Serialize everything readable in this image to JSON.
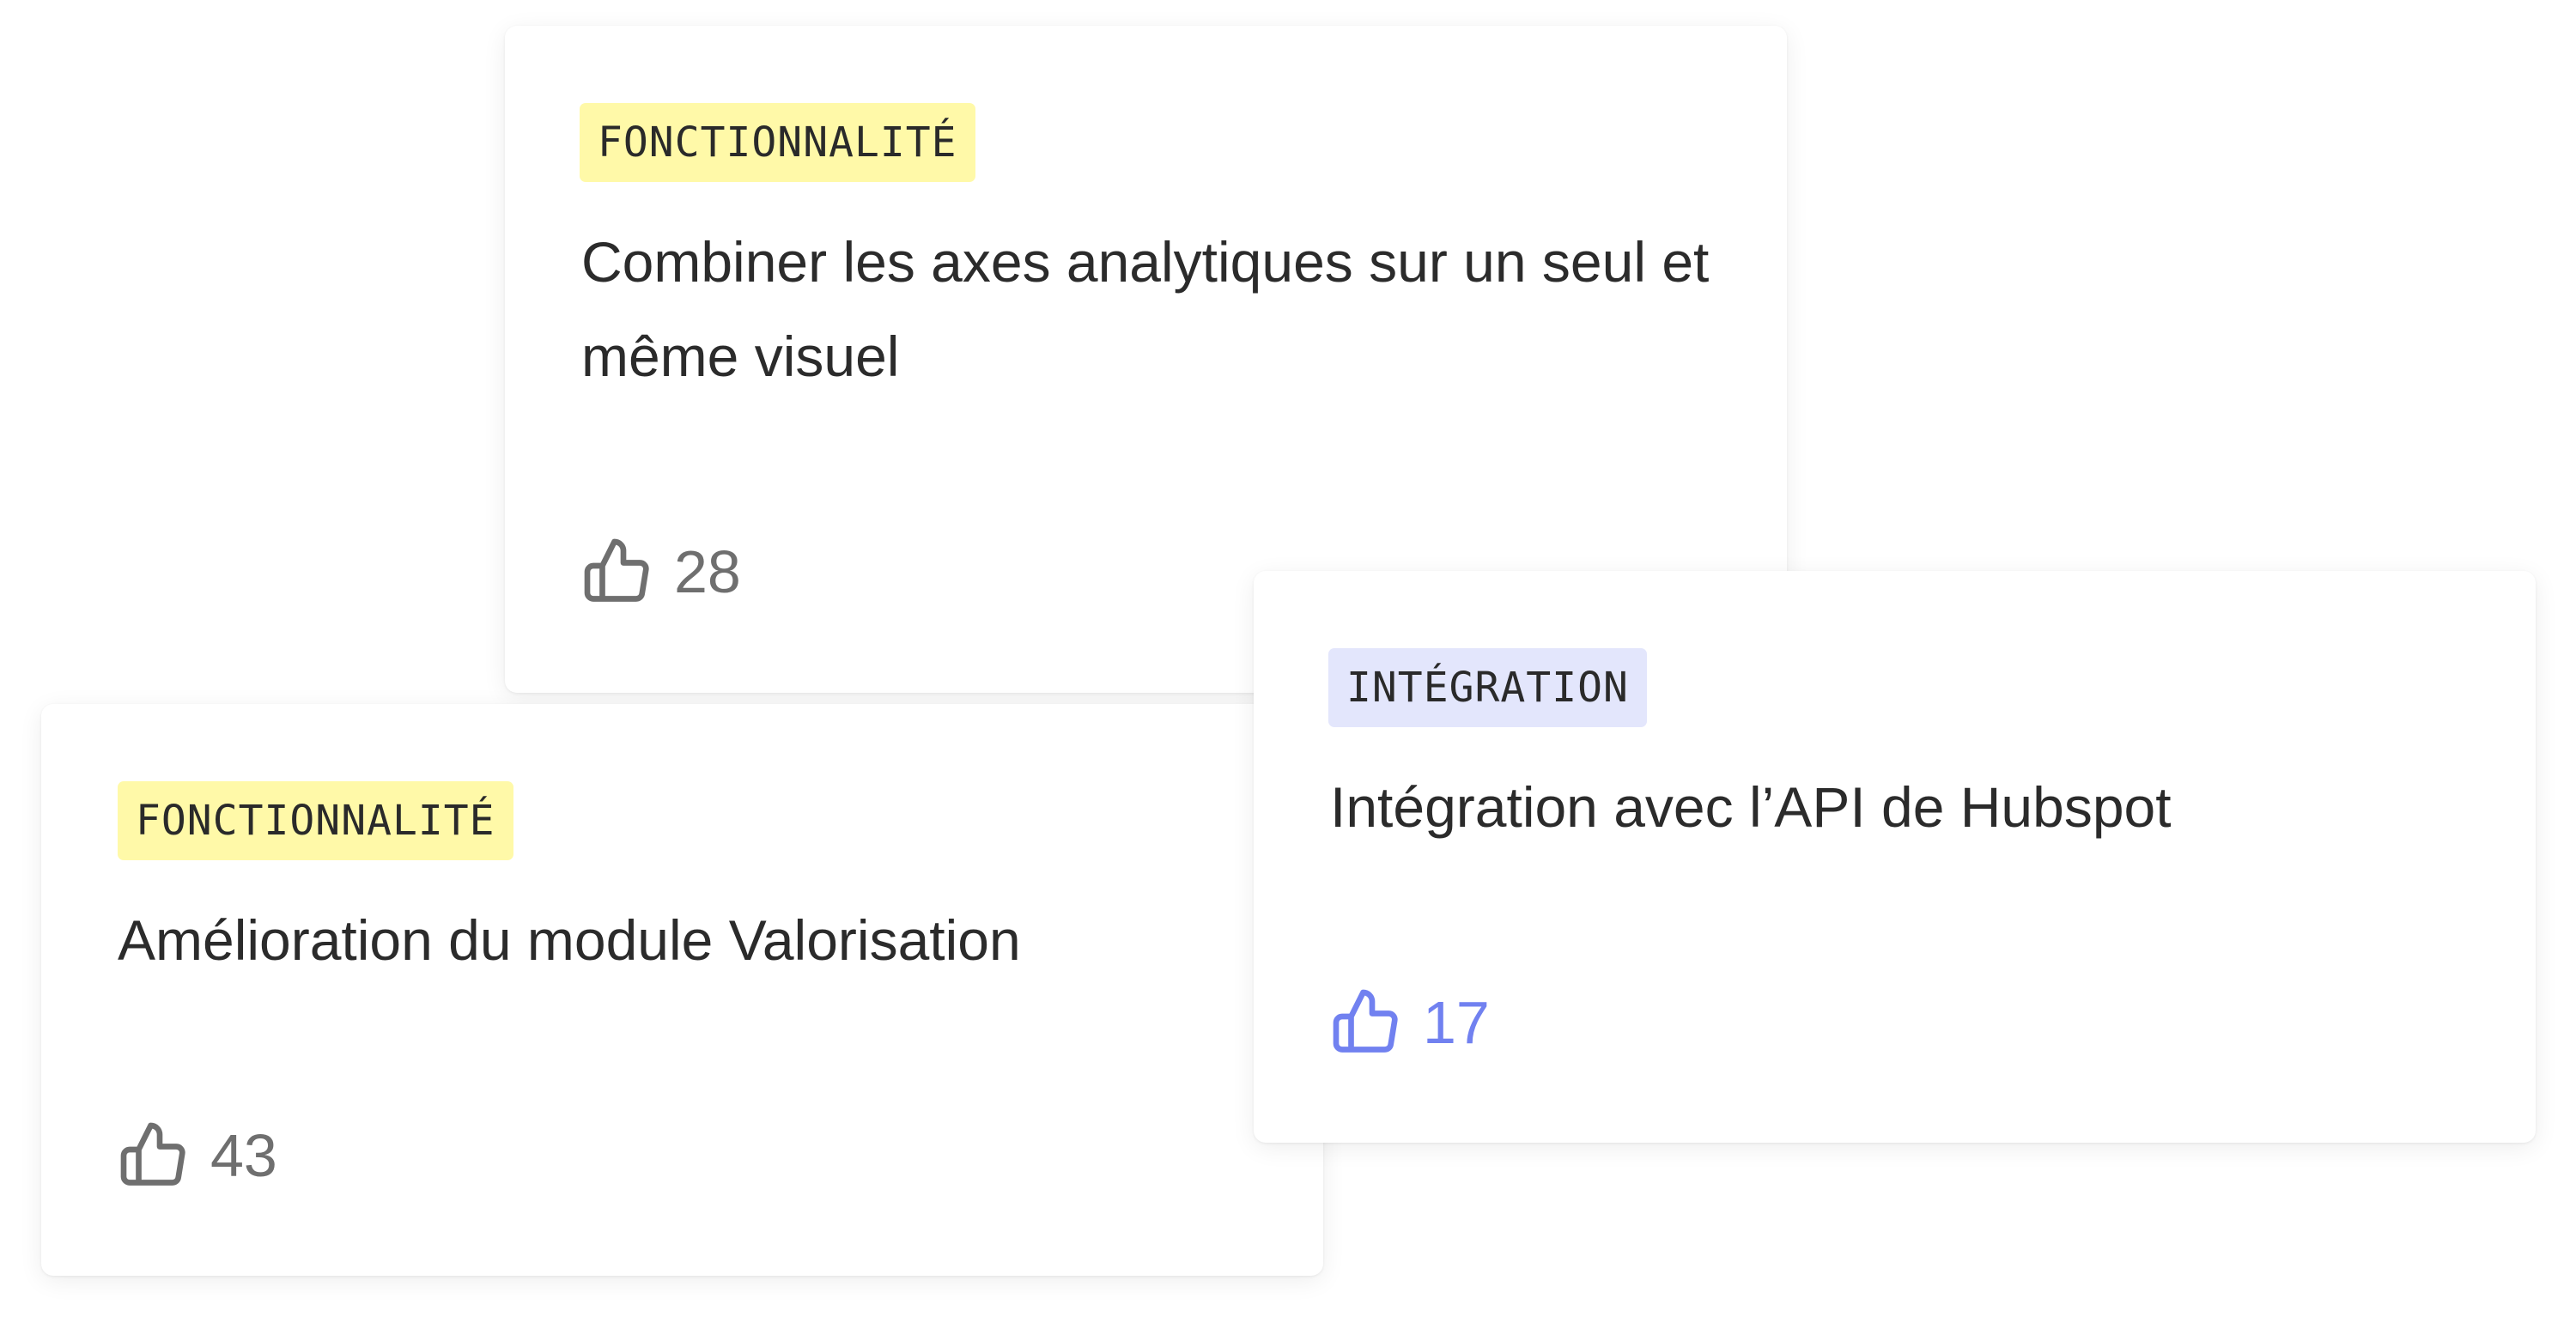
{
  "cards": [
    {
      "tag": "FONCTIONNALITÉ",
      "title": "Combiner les axes analytiques sur un seul et même visuel",
      "votes": "28",
      "tag_color": "#fff9a8",
      "vote_color": "#6f6f6f",
      "icon": "thumbs-up-icon"
    },
    {
      "tag": "FONCTIONNALITÉ",
      "title": "Amélioration du module Valorisation",
      "votes": "43",
      "tag_color": "#fff9a8",
      "vote_color": "#6f6f6f",
      "icon": "thumbs-up-icon"
    },
    {
      "tag": "INTÉGRATION",
      "title": "Intégration avec l’API de Hubspot",
      "votes": "17",
      "tag_color": "#e3e6fc",
      "vote_color": "#7181f0",
      "icon": "thumbs-up-icon"
    }
  ]
}
